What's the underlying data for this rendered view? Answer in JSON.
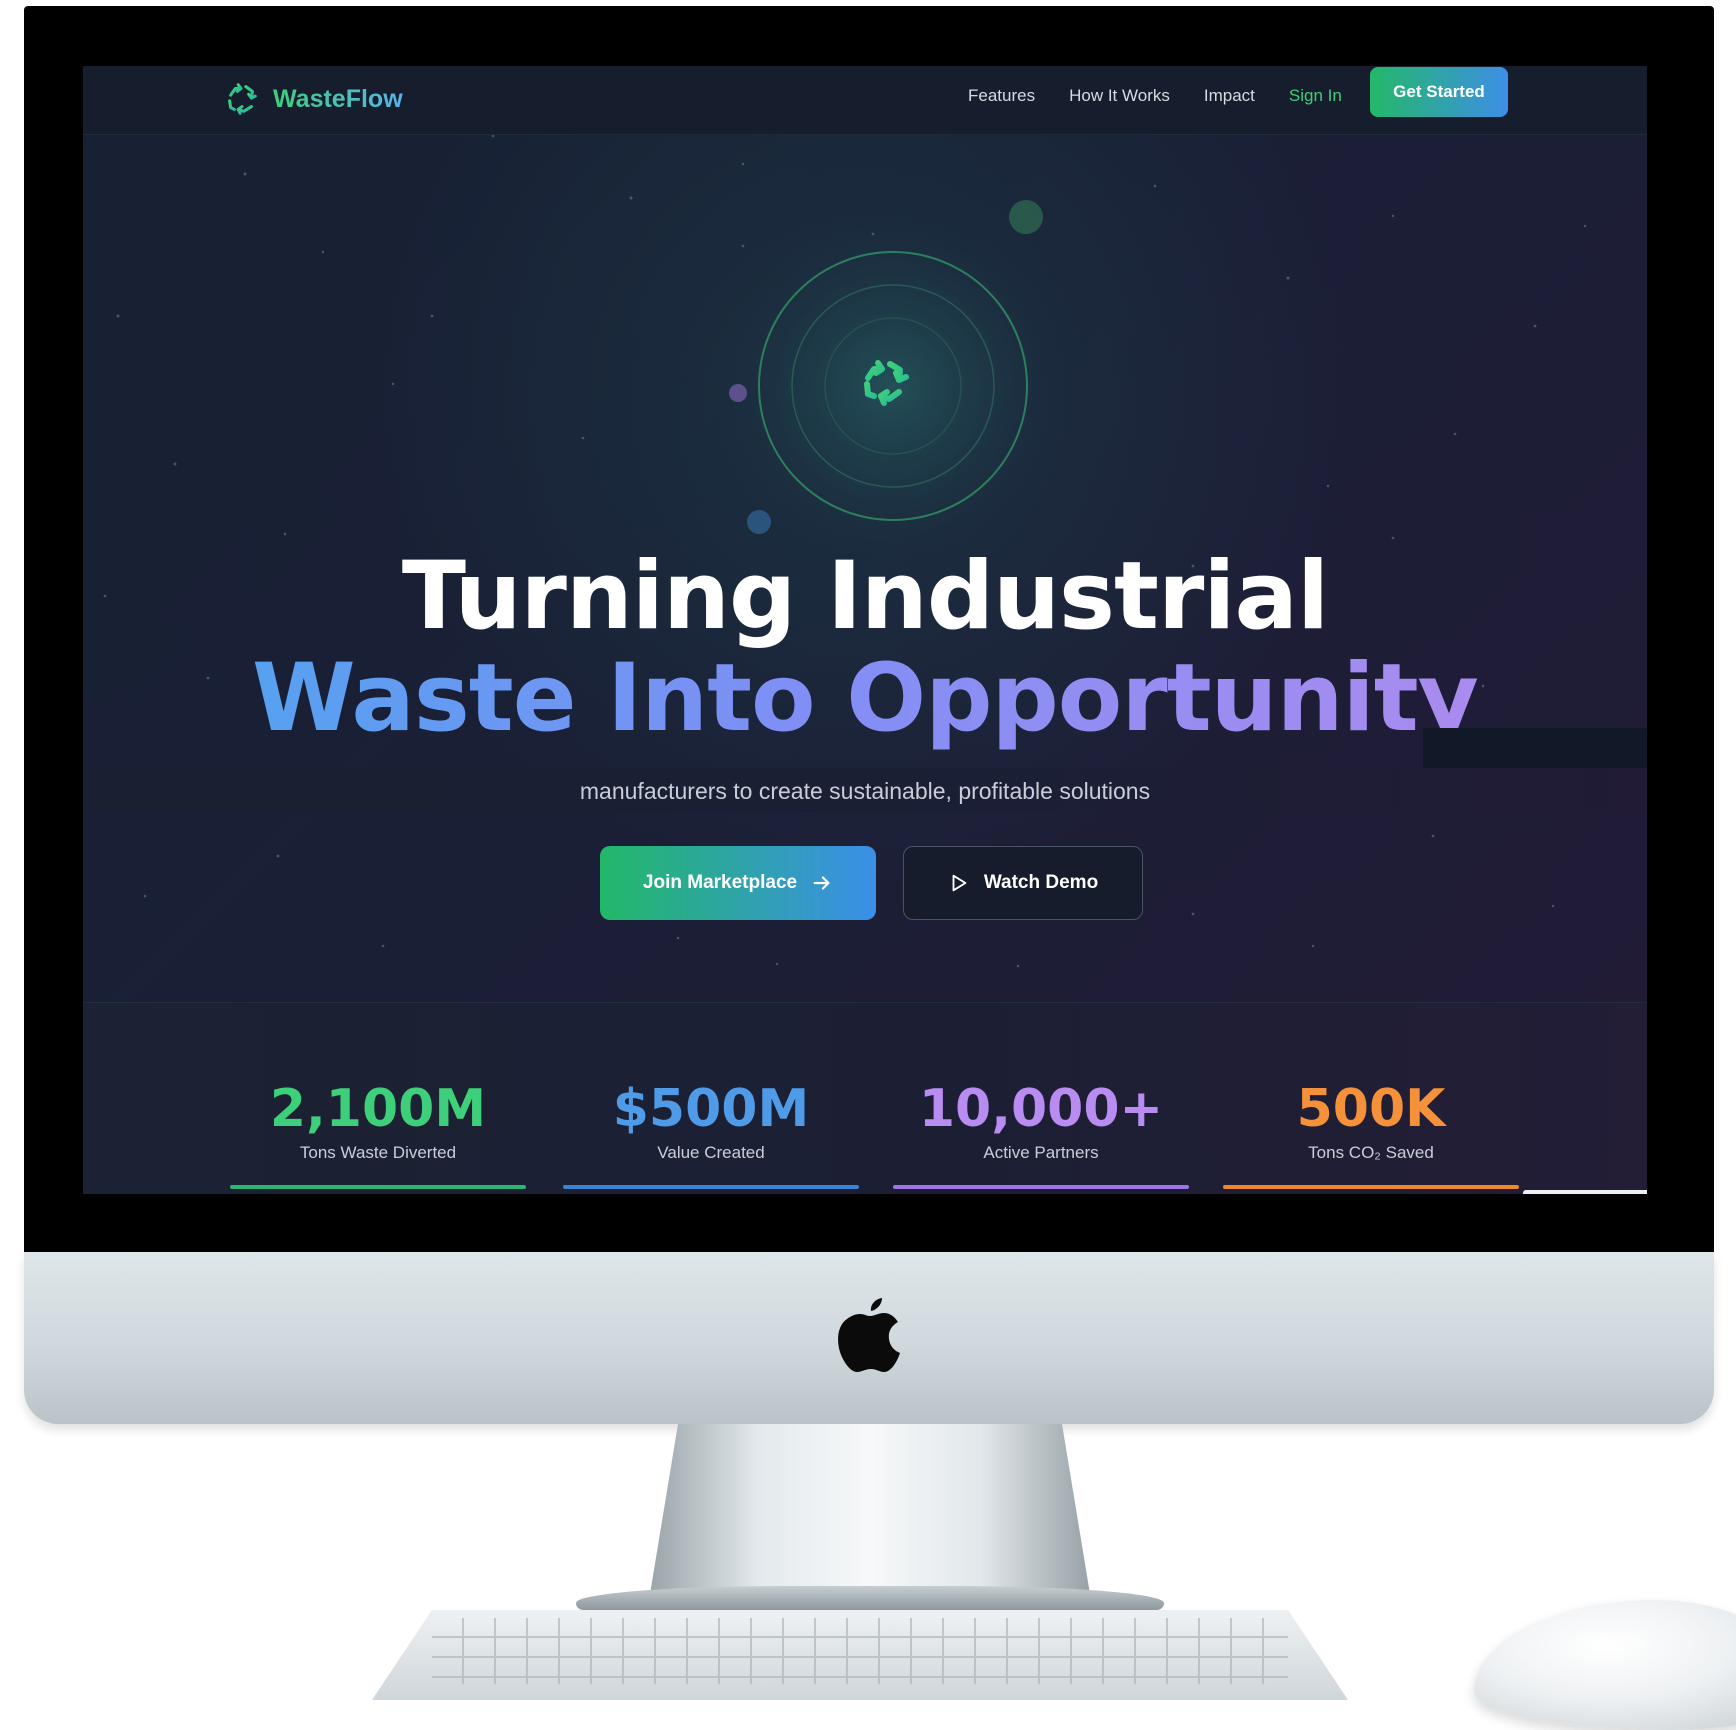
{
  "nav": {
    "brand": "WasteFlow",
    "links": [
      "Features",
      "How It Works",
      "Impact",
      "Sign In"
    ],
    "cta": "Get Started"
  },
  "hero": {
    "headline_line1": "Turning Industrial",
    "headline_line2": "Waste Into Opportunity",
    "subtitle": "manufacturers to create sustainable, profitable solutions",
    "primary_button": "Join Marketplace",
    "secondary_button": "Watch Demo"
  },
  "stats": [
    {
      "value": "2,100M",
      "label": "Tons Waste Diverted",
      "color": "#3ecf7a",
      "bar_color": "#2bb673"
    },
    {
      "value": "$500M",
      "label": "Value Created",
      "color": "#4f9be8",
      "bar_color": "#3a84d8"
    },
    {
      "value": "10,000+",
      "label": "Active Partners",
      "color": "#b98cf2",
      "bar_color": "#a173e8"
    },
    {
      "value": "500K",
      "label": "Tons CO₂ Saved",
      "color": "#f5913a",
      "bar_color": "#f2862a"
    }
  ],
  "icons": {
    "brand": "recycle-icon",
    "hero": "recycle-icon",
    "join": "arrow-right-icon",
    "demo": "play-icon",
    "device": "apple-logo-icon"
  },
  "colors": {
    "accent_green": "#3ecf7a",
    "accent_blue": "#3d8fe6",
    "accent_purple": "#b58aed",
    "background": "#1a1f36"
  }
}
